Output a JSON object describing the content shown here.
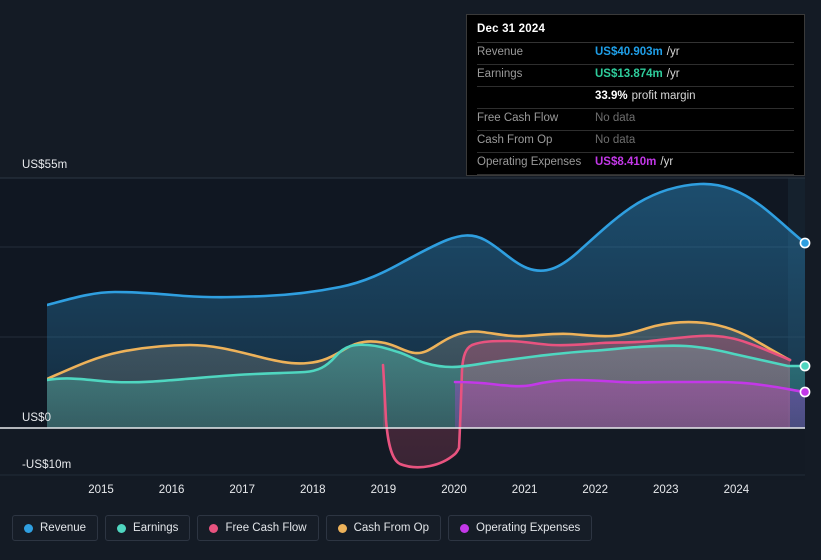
{
  "chart_data": {
    "type": "area",
    "title": "",
    "xlabel": "",
    "ylabel": "",
    "ylim": [
      -10,
      55
    ],
    "y_ticks": [
      {
        "label": "US$55m",
        "value": 55
      },
      {
        "label": "US$0",
        "value": 0
      },
      {
        "label": "-US$10m",
        "value": -10
      }
    ],
    "x_ticks": [
      "2015",
      "2016",
      "2017",
      "2018",
      "2019",
      "2020",
      "2021",
      "2022",
      "2023",
      "2024"
    ],
    "x_range": [
      "2014-06",
      "2025-03"
    ],
    "grid": true,
    "legend_position": "bottom-left",
    "currency": "US$",
    "units": "millions",
    "series": [
      {
        "name": "Revenue",
        "color": "#2f9fe0",
        "x": [
          "2014.5",
          "2015.0",
          "2015.5",
          "2016.0",
          "2016.5",
          "2017.0",
          "2017.5",
          "2018.0",
          "2018.5",
          "2019.0",
          "2019.5",
          "2020.0",
          "2020.5",
          "2021.0",
          "2021.5",
          "2022.0",
          "2022.5",
          "2023.0",
          "2023.5",
          "2024.0",
          "2024.5",
          "2025.0"
        ],
        "values": [
          27.0,
          28.4,
          29.6,
          29.8,
          29.3,
          29.0,
          29.2,
          29.6,
          31.0,
          33.2,
          36.5,
          36.8,
          32.3,
          31.6,
          35.2,
          42.0,
          45.5,
          48.5,
          49.5,
          48.0,
          45.0,
          40.903
        ],
        "last_value": 40.903
      },
      {
        "name": "Earnings",
        "color": "#4fd6c0",
        "x": [
          "2014.5",
          "2015.0",
          "2015.5",
          "2016.0",
          "2016.5",
          "2017.0",
          "2017.5",
          "2018.0",
          "2018.5",
          "2019.0",
          "2019.5",
          "2020.0",
          "2020.5",
          "2021.0",
          "2021.5",
          "2022.0",
          "2022.5",
          "2023.0",
          "2023.5",
          "2024.0",
          "2024.5",
          "2025.0"
        ],
        "values": [
          10.5,
          10.9,
          10.4,
          10.4,
          10.6,
          11.1,
          11.6,
          11.3,
          16.0,
          17.5,
          15.0,
          12.8,
          13.2,
          13.4,
          15.2,
          16.5,
          17.0,
          17.8,
          17.6,
          16.8,
          15.6,
          13.874
        ],
        "last_value": 13.874
      },
      {
        "name": "Free Cash Flow",
        "color": "#e8537f",
        "x": [
          "2018.6",
          "2018.9",
          "2019.1",
          "2019.4",
          "2019.8",
          "2020.0",
          "2020.2",
          "2020.5",
          "2021.0",
          "2021.5",
          "2022.0",
          "2022.5",
          "2023.0",
          "2023.5",
          "2024.0",
          "2024.4"
        ],
        "values": [
          14.0,
          14.5,
          -9.0,
          -10.2,
          -9.8,
          -8.6,
          14.0,
          18.0,
          19.0,
          19.6,
          20.4,
          20.2,
          22.0,
          21.6,
          19.5,
          16.0
        ],
        "note": "No data at latest period"
      },
      {
        "name": "Cash From Op",
        "color": "#edb25a",
        "x": [
          "2014.5",
          "2015.0",
          "2015.5",
          "2016.0",
          "2016.5",
          "2017.0",
          "2017.5",
          "2018.0",
          "2018.5",
          "2019.0",
          "2019.5",
          "2020.0",
          "2020.5",
          "2021.0",
          "2021.5",
          "2022.0",
          "2022.5",
          "2023.0",
          "2023.5",
          "2024.0",
          "2024.4"
        ],
        "values": [
          10.8,
          13.0,
          15.4,
          15.8,
          14.4,
          13.6,
          14.6,
          16.2,
          16.0,
          15.4,
          17.2,
          18.4,
          20.4,
          20.6,
          20.0,
          20.8,
          20.6,
          22.2,
          22.0,
          20.0,
          16.4
        ],
        "note": "No data at latest period"
      },
      {
        "name": "Operating Expenses",
        "color": "#c338e8",
        "x": [
          "2020.0",
          "2020.5",
          "2021.0",
          "2021.5",
          "2022.0",
          "2022.5",
          "2023.0",
          "2023.5",
          "2024.0",
          "2024.5",
          "2025.0"
        ],
        "values": [
          10.2,
          10.2,
          9.4,
          9.6,
          10.2,
          10.0,
          10.0,
          10.0,
          9.9,
          9.4,
          8.41
        ],
        "last_value": 8.41
      }
    ]
  },
  "tooltip": {
    "title": "Dec 31 2024",
    "rows": [
      {
        "label": "Revenue",
        "value": "US$40.903m",
        "suffix": "/yr",
        "color": "#1f9fe8",
        "has_data": true
      },
      {
        "label": "Earnings",
        "value": "US$13.874m",
        "suffix": "/yr",
        "color": "#2ecc9b",
        "has_data": true
      },
      {
        "label": "",
        "value": "33.9%",
        "suffix": "profit margin",
        "color": "#ffffff",
        "has_data": true
      },
      {
        "label": "Free Cash Flow",
        "value": "No data",
        "suffix": "",
        "color": "#6e6e6e",
        "has_data": false
      },
      {
        "label": "Cash From Op",
        "value": "No data",
        "suffix": "",
        "color": "#6e6e6e",
        "has_data": false
      },
      {
        "label": "Operating Expenses",
        "value": "US$8.410m",
        "suffix": "/yr",
        "color": "#c338e8",
        "has_data": true
      }
    ]
  },
  "legend": {
    "items": [
      {
        "label": "Revenue",
        "color": "#2f9fe0"
      },
      {
        "label": "Earnings",
        "color": "#4fd6c0"
      },
      {
        "label": "Free Cash Flow",
        "color": "#e8537f"
      },
      {
        "label": "Cash From Op",
        "color": "#edb25a"
      },
      {
        "label": "Operating Expenses",
        "color": "#c338e8"
      }
    ]
  },
  "theme": {
    "background": "#141b25",
    "plot_background": "#101722",
    "gridline": "#2a3440",
    "zero_line": "#e8eaed",
    "text": "#e8eaed"
  }
}
